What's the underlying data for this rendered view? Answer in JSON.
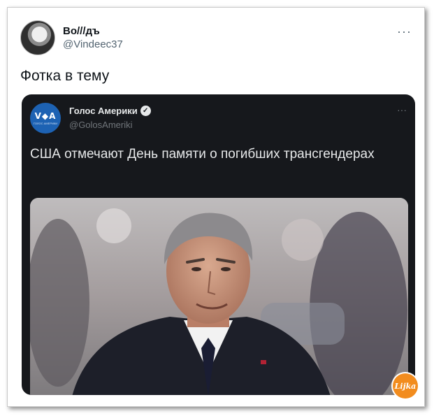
{
  "tweet": {
    "author_name": "Во///дъ",
    "author_handle": "@Vindeec37",
    "text": "Фотка в тему",
    "more_icon": "more-horizontal-icon"
  },
  "quoted_tweet": {
    "author_name": "Голос Америки",
    "author_handle": "@GolosAmeriki",
    "logo_text": "V◆A",
    "logo_subtext": "ГОЛОС АМЕРИКИ",
    "verified_icon": "verified-badge-icon",
    "text": "США отмечают День памяти о погибших трансгендерах",
    "more_icon": "more-horizontal-icon"
  },
  "watermark": {
    "text": "Lijka",
    "color": "#f28c1e"
  },
  "colors": {
    "quote_background": "#16181c",
    "voa_blue": "#1d62b3"
  }
}
